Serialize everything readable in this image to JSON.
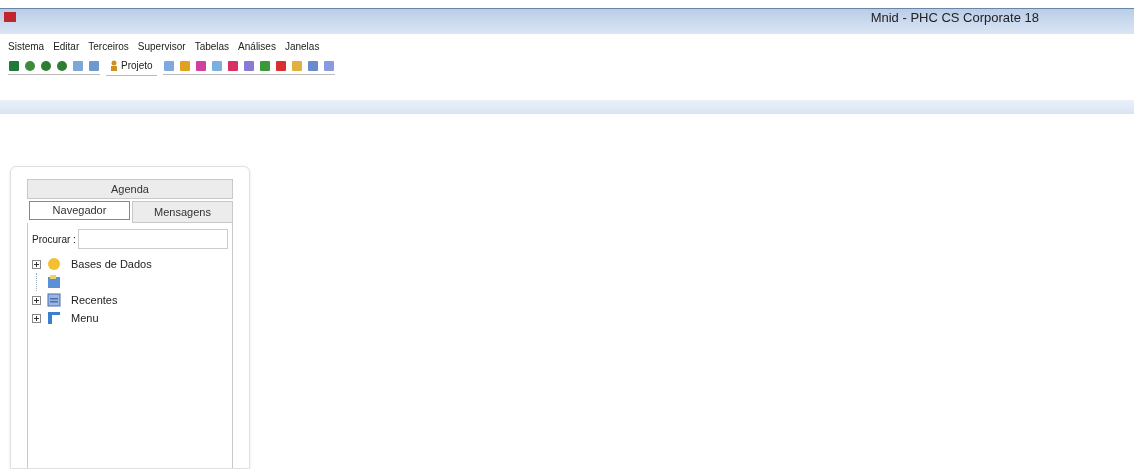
{
  "window": {
    "title": "Mnid - PHC CS Corporate 18"
  },
  "menu": [
    "Sistema",
    "Editar",
    "Terceiros",
    "Supervisor",
    "Tabelas",
    "Análises",
    "Janelas"
  ],
  "toolbar": {
    "project_button": "Projeto"
  },
  "panel": {
    "header": "Agenda",
    "tabs": [
      {
        "label": "Navegador",
        "selected": true
      },
      {
        "label": "Mensagens",
        "selected": false
      }
    ],
    "search": {
      "label": "Procurar :"
    },
    "tree": [
      {
        "kind": "database",
        "label": "Bases de Dados",
        "expanded": false,
        "children": [
          {
            "kind": "file"
          }
        ]
      },
      {
        "kind": "recent",
        "label": "Recentes",
        "expanded": false
      },
      {
        "kind": "menu",
        "label": "Menu",
        "expanded": false
      }
    ]
  }
}
